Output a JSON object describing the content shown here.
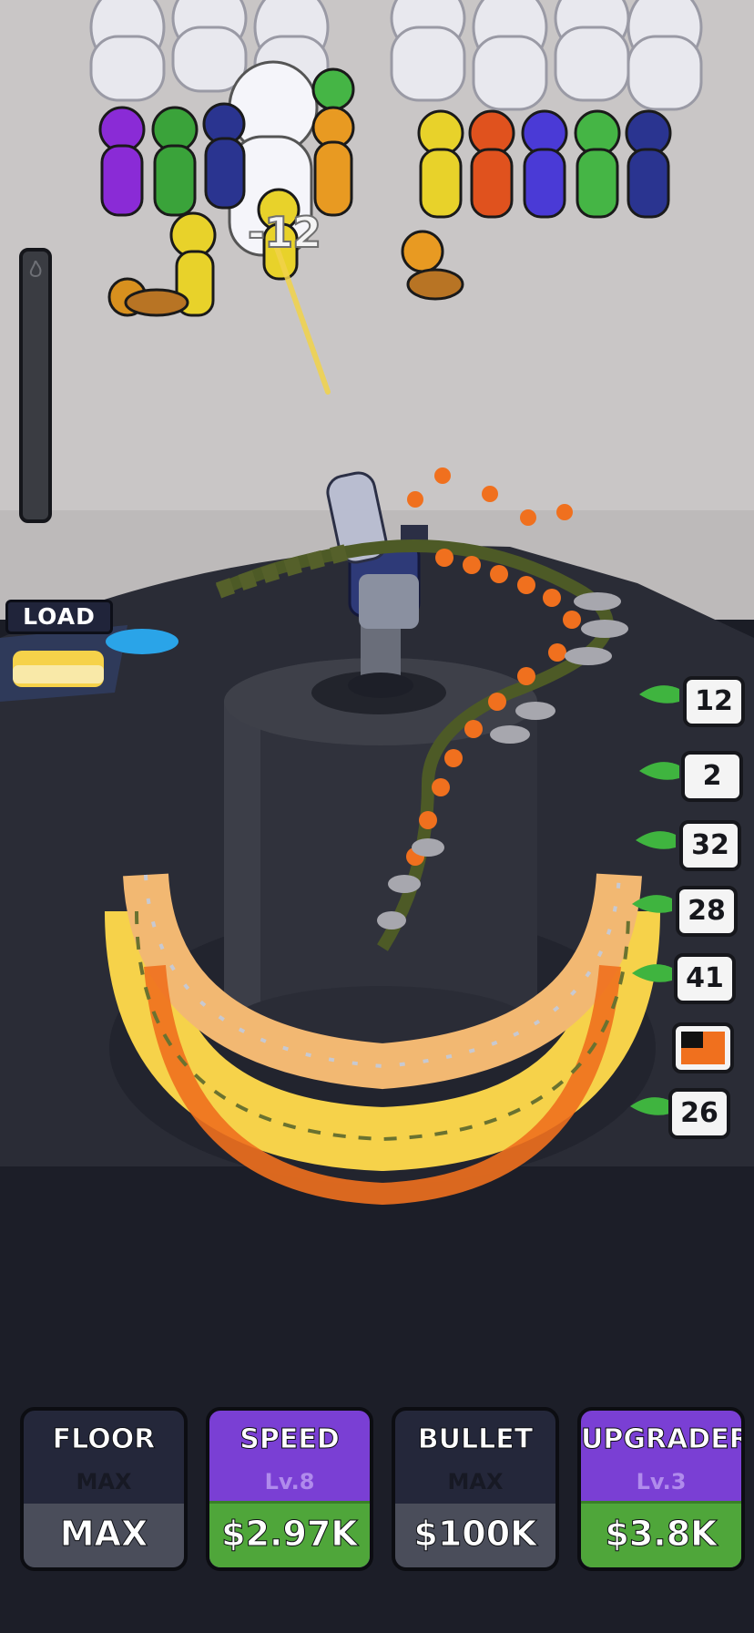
{
  "hud": {
    "load_label": "LOAD",
    "damage_popup": "-12",
    "heat_level": 0.0,
    "heat_icon": "flame-icon"
  },
  "counters": [
    {
      "value": "12"
    },
    {
      "value": "2"
    },
    {
      "value": "32"
    },
    {
      "value": "28"
    },
    {
      "value": "41"
    },
    {
      "icon": "flag-icon"
    },
    {
      "value": "26"
    }
  ],
  "upgrades": [
    {
      "title": "FLOOR",
      "level": "MAX",
      "price": "MAX",
      "style": "dark"
    },
    {
      "title": "SPEED",
      "level": "Lv.8",
      "price": "$2.97K",
      "style": "purple"
    },
    {
      "title": "BULLET",
      "level": "MAX",
      "price": "$100K",
      "style": "dark"
    },
    {
      "title": "UPGRADER",
      "level": "Lv.3",
      "price": "$3.8K",
      "style": "purple"
    }
  ],
  "colors": {
    "ground": "#c9c6c6",
    "arena_dark": "#2a2c36",
    "price_green": "#4fa63a",
    "button_purple": "#7a3fd4",
    "bullet_orange": "#f0701e",
    "bullet_yellow": "#f6d24a"
  }
}
